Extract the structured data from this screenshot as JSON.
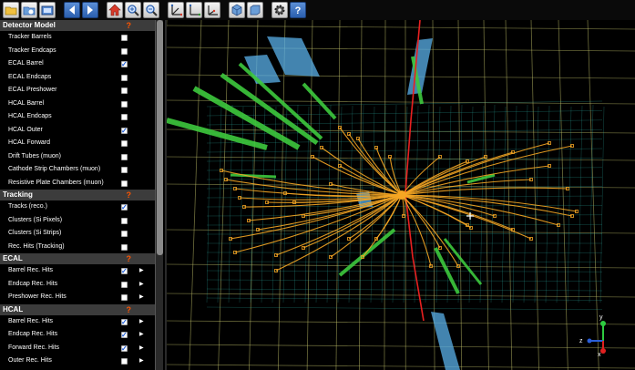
{
  "toolbar": {
    "buttons": [
      {
        "name": "open-file-button",
        "icon": "folder-icon"
      },
      {
        "name": "open-url-button",
        "icon": "folder-web-icon"
      },
      {
        "name": "load-event-button",
        "icon": "image-icon"
      },
      {
        "name": "previous-event-button",
        "icon": "arrow-left-icon"
      },
      {
        "name": "next-event-button",
        "icon": "arrow-right-icon"
      },
      {
        "name": "home-view-button",
        "icon": "home-icon"
      },
      {
        "name": "zoom-in-button",
        "icon": "zoom-in-icon"
      },
      {
        "name": "zoom-out-button",
        "icon": "zoom-out-icon"
      },
      {
        "name": "xy-view-button",
        "icon": "axes-xy-icon"
      },
      {
        "name": "rz-view-button",
        "icon": "axes-rz-icon"
      },
      {
        "name": "yz-view-button",
        "icon": "axes-yz-icon"
      },
      {
        "name": "perspective-button",
        "icon": "cube-icon"
      },
      {
        "name": "orthographic-button",
        "icon": "square-icon"
      },
      {
        "name": "settings-button",
        "icon": "gear-icon"
      },
      {
        "name": "help-button",
        "icon": "help-icon"
      }
    ]
  },
  "sidebar": {
    "sections": [
      {
        "title": "Detector Model",
        "help": "?",
        "items": [
          {
            "label": "Tracker Barrels",
            "checked": false,
            "arrow": false
          },
          {
            "label": "Tracker Endcaps",
            "checked": false,
            "arrow": false
          },
          {
            "label": "ECAL Barrel",
            "checked": true,
            "arrow": false
          },
          {
            "label": "ECAL Endcaps",
            "checked": false,
            "arrow": false
          },
          {
            "label": "ECAL Preshower",
            "checked": false,
            "arrow": false
          },
          {
            "label": "HCAL Barrel",
            "checked": false,
            "arrow": false
          },
          {
            "label": "HCAL Endcaps",
            "checked": false,
            "arrow": false
          },
          {
            "label": "HCAL Outer",
            "checked": true,
            "arrow": false
          },
          {
            "label": "HCAL Forward",
            "checked": false,
            "arrow": false
          },
          {
            "label": "Drift Tubes (muon)",
            "checked": false,
            "arrow": false
          },
          {
            "label": "Cathode Strip Chambers (muon)",
            "checked": false,
            "arrow": false
          },
          {
            "label": "Resistive Plate Chambers (muon)",
            "checked": false,
            "arrow": false
          }
        ]
      },
      {
        "title": "Tracking",
        "help": "?",
        "items": [
          {
            "label": "Tracks (reco.)",
            "checked": true,
            "arrow": false
          },
          {
            "label": "Clusters (Si Pixels)",
            "checked": false,
            "arrow": false
          },
          {
            "label": "Clusters (Si Strips)",
            "checked": false,
            "arrow": false
          },
          {
            "label": "Rec. Hits (Tracking)",
            "checked": false,
            "arrow": false
          }
        ]
      },
      {
        "title": "ECAL",
        "help": "?",
        "items": [
          {
            "label": "Barrel Rec. Hits",
            "checked": true,
            "arrow": true
          },
          {
            "label": "Endcap Rec. Hits",
            "checked": false,
            "arrow": true
          },
          {
            "label": "Preshower Rec. Hits",
            "checked": false,
            "arrow": true
          }
        ]
      },
      {
        "title": "HCAL",
        "help": "?",
        "items": [
          {
            "label": "Barrel Rec. Hits",
            "checked": true,
            "arrow": true
          },
          {
            "label": "Endcap Rec. Hits",
            "checked": true,
            "arrow": true
          },
          {
            "label": "Forward Rec. Hits",
            "checked": true,
            "arrow": true
          },
          {
            "label": "Outer Rec. Hits",
            "checked": false,
            "arrow": true
          }
        ]
      }
    ]
  },
  "viewport": {
    "axes_labels": {
      "y": "y",
      "z": "z",
      "x": "x"
    },
    "colors": {
      "tracks": "#f5a623",
      "hcal": "#3ec93e",
      "ecal": "#5ab0ea",
      "beam": "#e82020",
      "grid": "#c8c86e",
      "mesh": "#2fb3a8"
    }
  }
}
